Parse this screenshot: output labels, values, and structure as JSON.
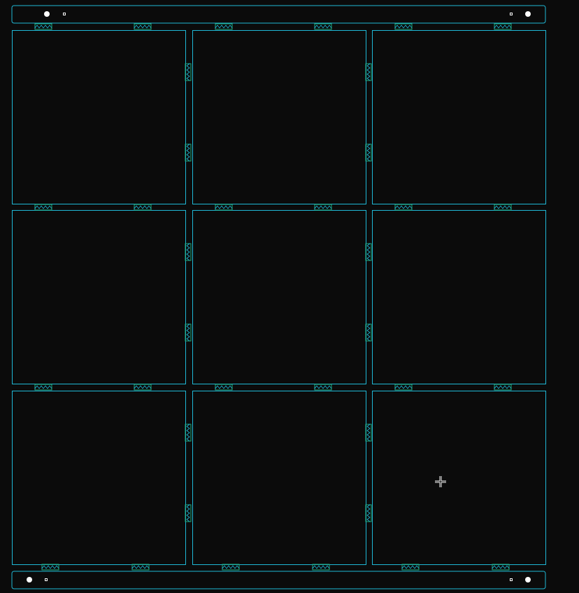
{
  "view": {
    "background": "#0b0b0b",
    "outline_color": "#1fb8d6",
    "tab_color": "#1fae7e",
    "hole_color": "#ffffff",
    "cursor_icon": "crosshair-cursor-icon"
  },
  "grid": {
    "rows": 3,
    "cols": 3,
    "panel_count": 9
  },
  "rails": [
    {
      "name": "top-rail"
    },
    {
      "name": "bottom-rail"
    }
  ]
}
